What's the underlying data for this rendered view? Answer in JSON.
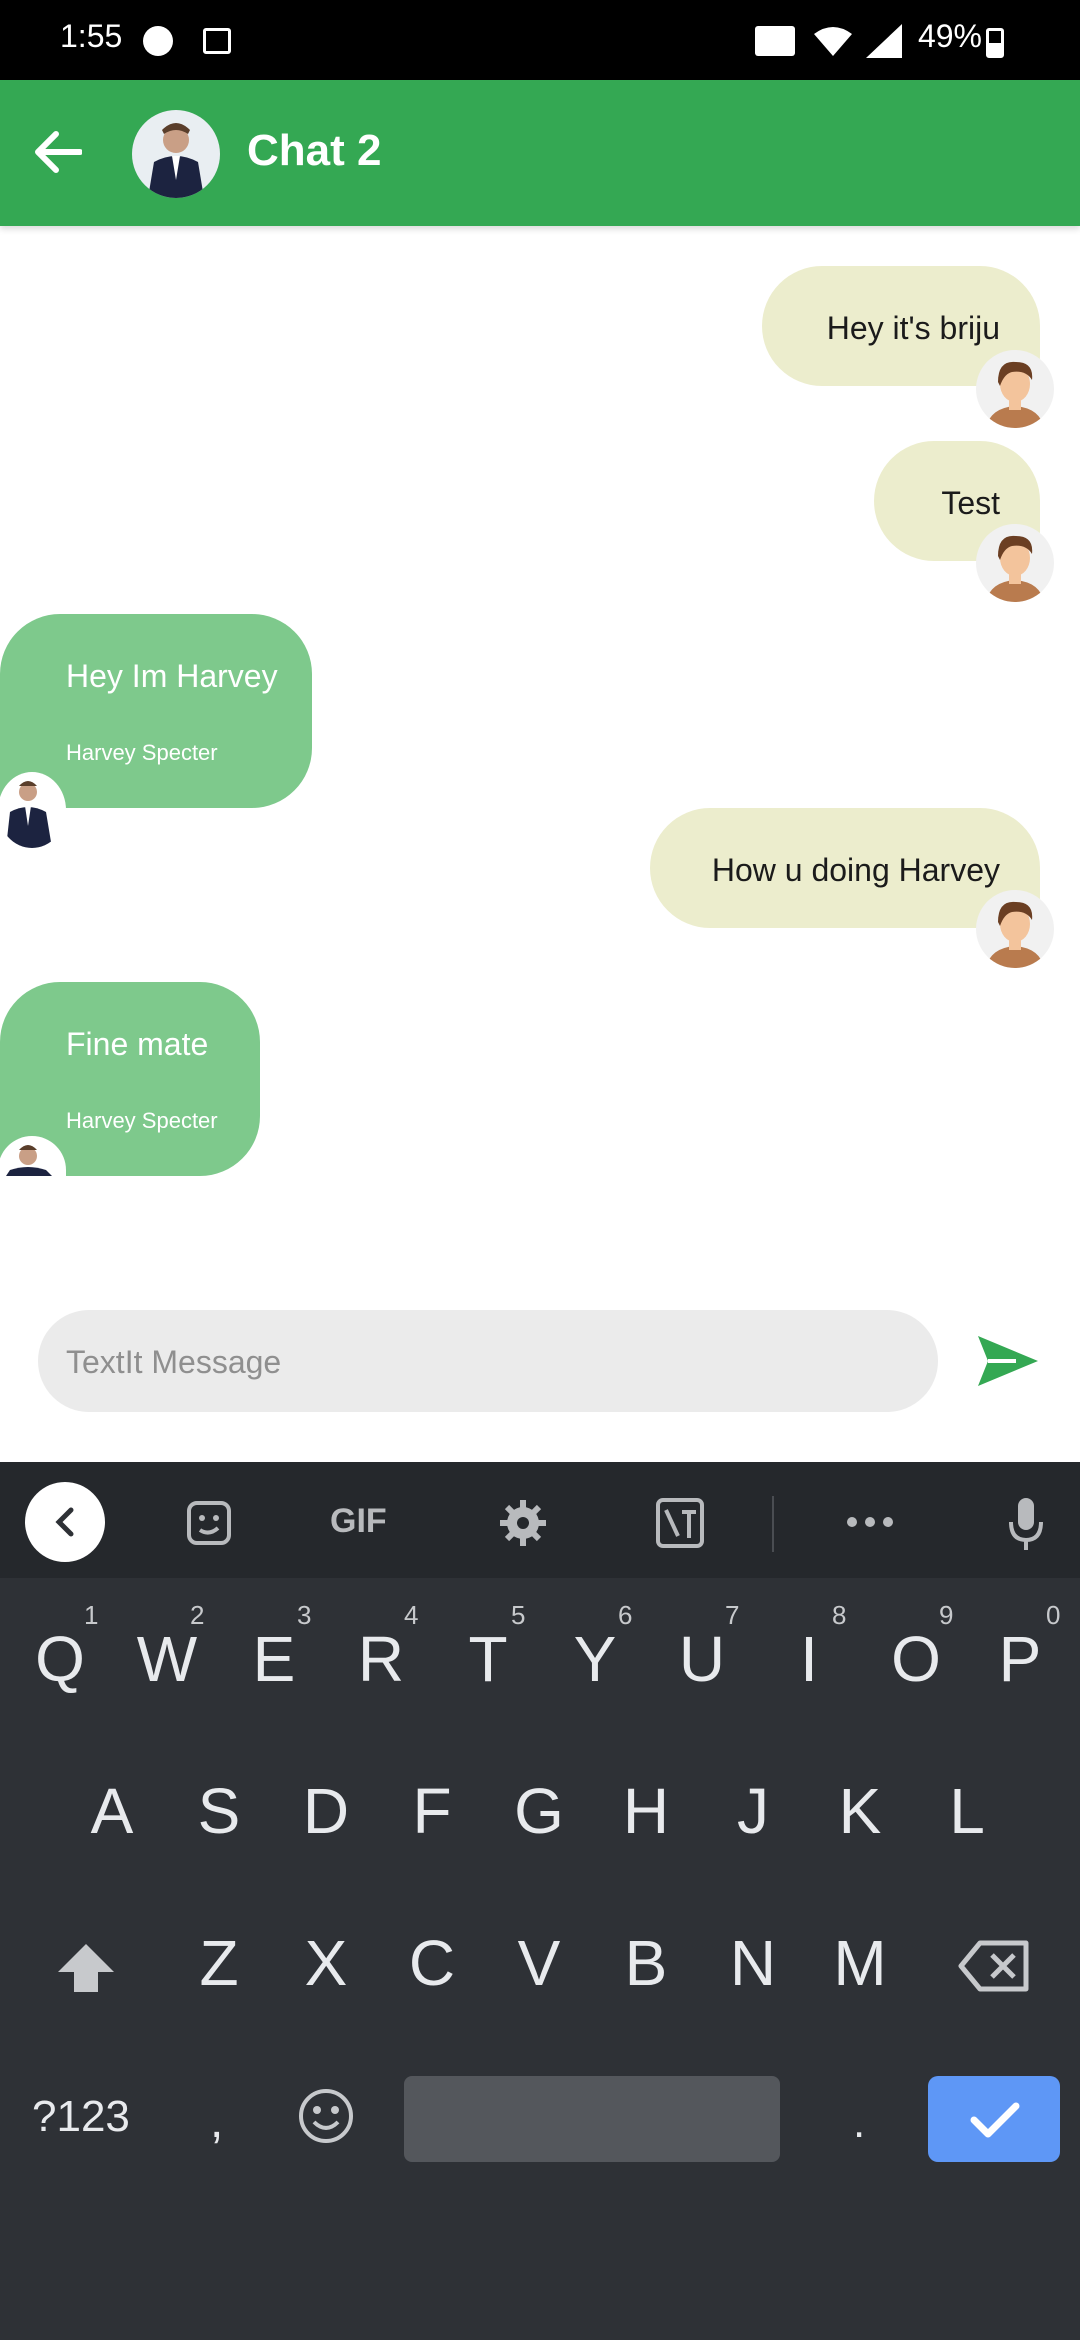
{
  "status_bar": {
    "time": "1:55",
    "battery": "49%"
  },
  "header": {
    "title": "Chat 2"
  },
  "messages": [
    {
      "direction": "out",
      "text": "Hey it's briju"
    },
    {
      "direction": "out",
      "text": "Test"
    },
    {
      "direction": "in",
      "text": "Hey Im Harvey",
      "sender": "Harvey Specter"
    },
    {
      "direction": "out",
      "text": "How u doing Harvey"
    },
    {
      "direction": "in",
      "text": "Fine mate",
      "sender": "Harvey Specter"
    }
  ],
  "composer": {
    "placeholder": "TextIt Message"
  },
  "keyboard": {
    "toolbar_gif": "GIF",
    "row1": [
      "Q",
      "W",
      "E",
      "R",
      "T",
      "Y",
      "U",
      "I",
      "O",
      "P"
    ],
    "row1_hints": [
      "1",
      "2",
      "3",
      "4",
      "5",
      "6",
      "7",
      "8",
      "9",
      "0"
    ],
    "row2": [
      "A",
      "S",
      "D",
      "F",
      "G",
      "H",
      "J",
      "K",
      "L"
    ],
    "row3": [
      "Z",
      "X",
      "C",
      "V",
      "B",
      "N",
      "M"
    ],
    "symbols_key": "?123",
    "comma_key": ",",
    "period_key": "."
  },
  "colors": {
    "primary": "#34a853",
    "outgoing_bubble": "#ecedcd",
    "incoming_bubble": "#7ec98c",
    "keyboard_bg": "#2e3136",
    "enter_key": "#5e97f6"
  }
}
